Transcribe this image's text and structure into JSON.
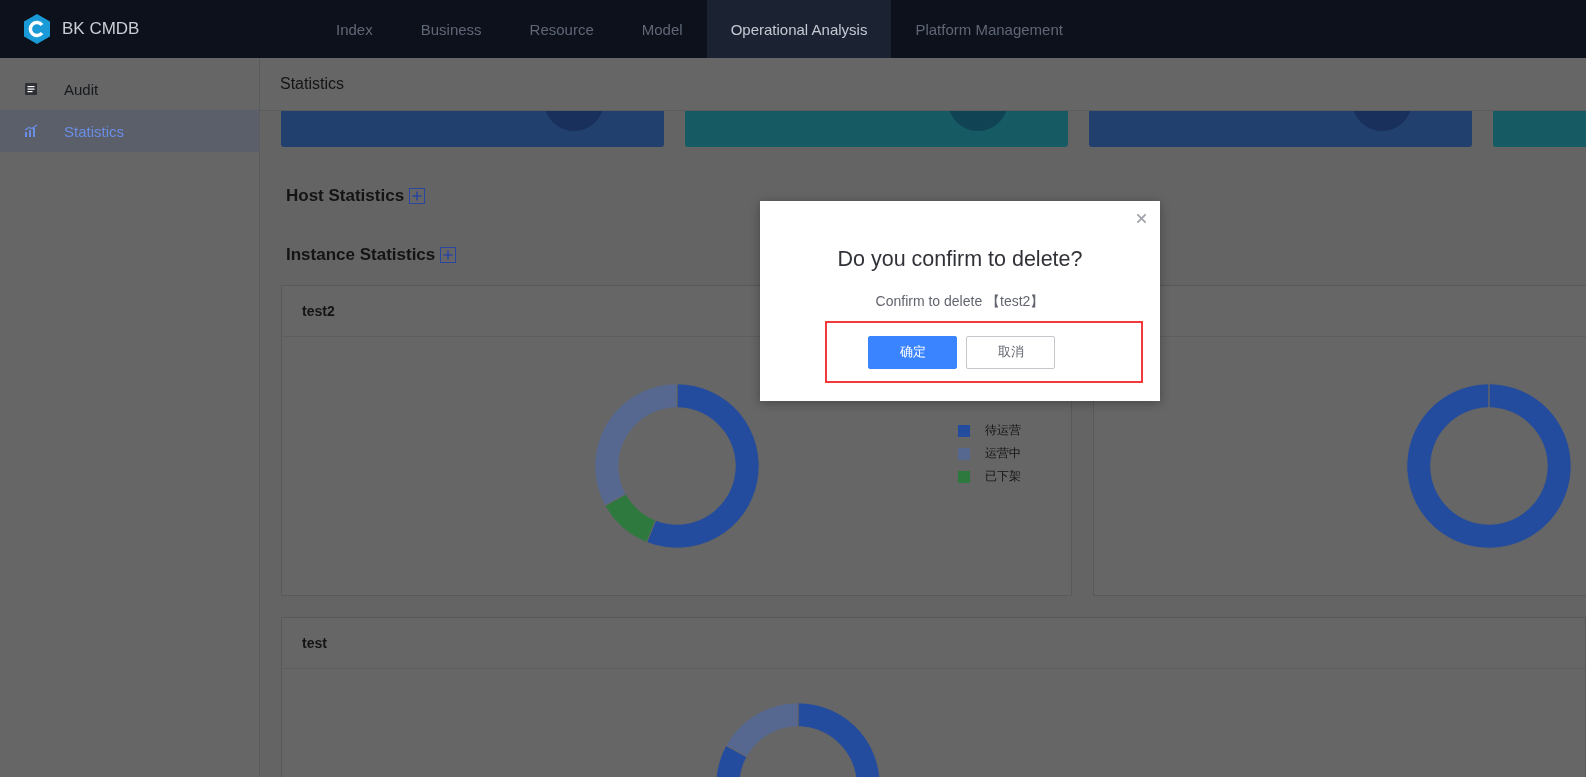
{
  "header": {
    "logo_text": "BK CMDB",
    "nav": [
      {
        "label": "Index",
        "selected": false
      },
      {
        "label": "Business",
        "selected": false
      },
      {
        "label": "Resource",
        "selected": false
      },
      {
        "label": "Model",
        "selected": false
      },
      {
        "label": "Operational Analysis",
        "selected": true
      },
      {
        "label": "Platform Management",
        "selected": false
      }
    ]
  },
  "sidebar": {
    "items": [
      {
        "label": "Audit",
        "kind": "document",
        "selected": false
      },
      {
        "label": "Statistics",
        "kind": "chart",
        "selected": true
      }
    ]
  },
  "page_title": "Statistics",
  "summary_cards": [
    {
      "color": "#22406e"
    },
    {
      "color": "#165a63"
    },
    {
      "color": "#22406e"
    },
    {
      "color": "#165a63"
    }
  ],
  "sections": [
    {
      "title": "Host Statistics"
    },
    {
      "title": "Instance Statistics"
    }
  ],
  "panels": [
    {
      "title": "test2",
      "kind": "donut",
      "legend": [
        {
          "label": "待运营",
          "color": "#244c9e"
        },
        {
          "label": "运营中",
          "color": "#566890"
        },
        {
          "label": "已下架",
          "color": "#2e7a3e"
        }
      ]
    },
    {
      "kind": "donut"
    },
    {
      "title": "test",
      "kind": "donut"
    }
  ],
  "dialog": {
    "title": "Do you confirm to delete?",
    "message": "Confirm to delete 【test2】",
    "buttons": [
      {
        "label": "确定",
        "kind": "primary"
      },
      {
        "label": "取消",
        "kind": "default"
      }
    ]
  }
}
